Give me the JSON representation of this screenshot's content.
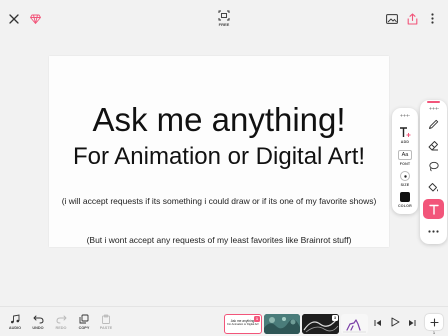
{
  "topbar": {
    "icons": [
      "close-icon",
      "gem-icon",
      "frame-icon",
      "image-icon",
      "share-icon",
      "more-vertical-icon"
    ],
    "frame_label": "FREE",
    "accent": "#f2557a"
  },
  "canvas": {
    "line1": "Ask me anything!",
    "line2": "For Animation or Digital Art!",
    "line3": "(i will accept requests if its something i could draw or if its one of my favorite shows)",
    "line4": "(But i wont accept any requests of my least favorites like Brainrot stuff)"
  },
  "text_panel": {
    "add_label": "ADD",
    "font_label": "FONT",
    "font_glyph": "Aa",
    "size_label": "SIZE",
    "color_label": "COLOR",
    "color_value": "#111111"
  },
  "tools": [
    "pen-icon",
    "eraser-icon",
    "lasso-icon",
    "fill-icon",
    "text-icon",
    "more-horizontal-icon"
  ],
  "toolbar": {
    "audio": "AUDIO",
    "undo": "UNDO",
    "redo": "REDO",
    "copy": "COPY",
    "paste": "PASTE"
  },
  "timeline": {
    "frame1_line1": "Ask me anything!",
    "frame1_line2": "For Animation or Digital Art!",
    "frame_count": "1",
    "frame_badge": "1",
    "frame_badge_2": "3"
  }
}
